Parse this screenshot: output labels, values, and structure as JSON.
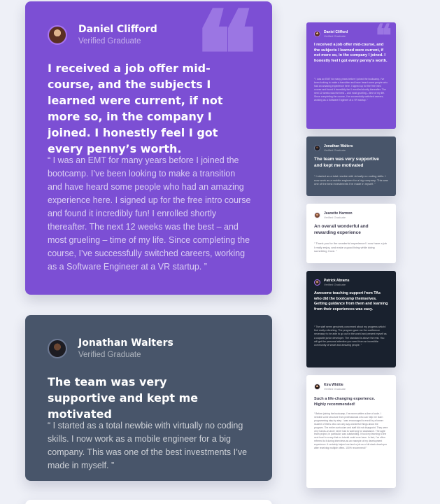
{
  "testimonials": [
    {
      "name": "Daniel Clifford",
      "status": "Verified Graduate",
      "title": "I received a job offer mid-course, and the subjects I learned were current, if not more so, in the company I joined. I honestly feel I got every penny’s worth.",
      "body": "“ I was an EMT for many years before I joined the bootcamp. I’ve been looking to make a transition and have heard some people who had an amazing experience here. I signed up for the free intro course and found it incredibly fun! I enrolled shortly thereafter. The next 12 weeks was the best – and most grueling – time of my life. Since completing the course, I’ve successfully switched careers, working as a Software Engineer at a VR startup. ”"
    },
    {
      "name": "Jonathan Walters",
      "status": "Verified Graduate",
      "title": "The team was very supportive and kept me motivated",
      "body": "“ I started as a total newbie with virtually no coding skills. I now work as a mobile engineer for a big company. This was one of the best investments I’ve made in myself. ”"
    },
    {
      "name": "Jeanette Harmon",
      "status": "Verified Graduate",
      "title": "An overall wonderful and rewarding experience",
      "body": "“ Thank you for the wonderful experience! I now have a job I really enjoy, and make a good living while doing something I love. ”"
    },
    {
      "name": "Patrick Abrams",
      "status": "Verified Graduate",
      "title": "Awesome teaching support from TAs who did the bootcamp themselves. Getting guidance from them and learning from their experiences was easy.",
      "body": "“ The staff seem genuinely concerned about my progress which I find really refreshing. The program gave me the confidence necessary to be able to go out in the world and present myself as a capable junior developer. The standard is above the rest. You will get the personal attention you need from an incredible community of smart and amazing people. ”"
    },
    {
      "name": "Kira Whittle",
      "status": "Verified Graduate",
      "title": "Such a life-changing experience. Highly recommended!",
      "body": "“ Before joining the bootcamp, I’ve never written a line of code. I needed some structure from professionals who can help me learn programming step by step. I was encouraged to enroll by a former student of theirs who can only say wonderful things about the program. The entire curriculum and staff did not disappoint. They were very hands-on and I never had to wait long for assistance. The agile team project, in particular, was outstanding. It took my learning to the next level in a way that no tutorial could ever have. In fact, I’ve often referred to it during interviews as an example of my development experience. It certainly helped me land a job as a full-stack developer after receiving multiple offers. 100% recommend! ”"
    }
  ],
  "decorations": {
    "quote_icon": "quote-icon"
  }
}
